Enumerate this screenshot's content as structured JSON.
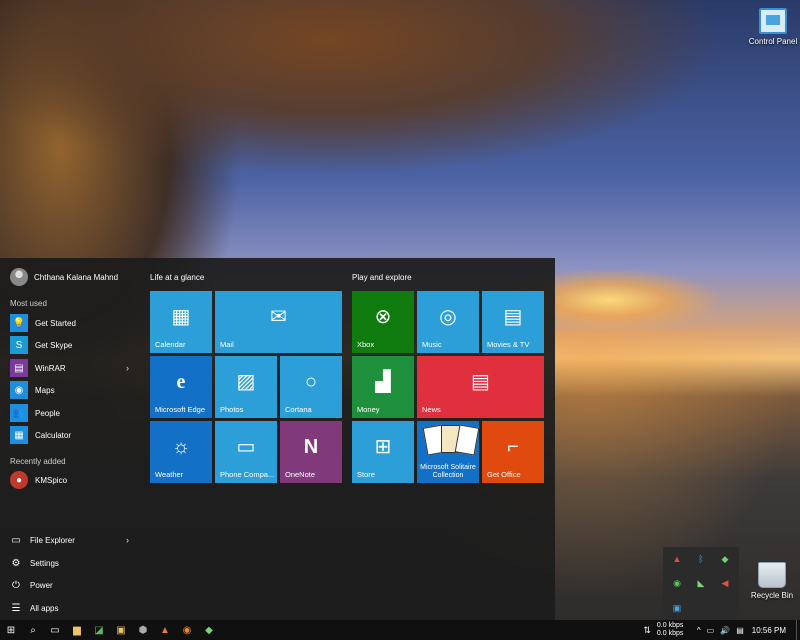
{
  "desktop": {
    "icons": [
      {
        "label": "Control Panel"
      },
      {
        "label": "Recycle Bin"
      }
    ]
  },
  "start_menu": {
    "user_name": "Chthana Kalana Mahnd",
    "most_used_header": "Most used",
    "most_used": [
      {
        "label": "Get Started",
        "color": "#1e8fdc"
      },
      {
        "label": "Get Skype",
        "color": "#1b9ad6"
      },
      {
        "label": "WinRAR",
        "color": "#7a3a9a"
      },
      {
        "label": "Maps",
        "color": "#1e8fdc"
      },
      {
        "label": "People",
        "color": "#1e8fdc"
      },
      {
        "label": "Calculator",
        "color": "#1e8fdc"
      }
    ],
    "recently_added_header": "Recently added",
    "recently_added": [
      {
        "label": "KMSpico",
        "color": "#c0392b"
      }
    ],
    "bottom": {
      "file_explorer": "File Explorer",
      "settings": "Settings",
      "power": "Power",
      "all_apps": "All apps"
    },
    "groups": {
      "life": "Life at a glance",
      "play": "Play and explore"
    },
    "tiles": {
      "calendar": "Calendar",
      "mail": "Mail",
      "edge": "Microsoft Edge",
      "photos": "Photos",
      "cortana": "Cortana",
      "weather": "Weather",
      "phone": "Phone Compa...",
      "onenote": "OneNote",
      "xbox": "Xbox",
      "music": "Music",
      "movies": "Movies & TV",
      "money": "Money",
      "news": "News",
      "store": "Store",
      "solitaire": "Microsoft Solitaire Collection",
      "office": "Get Office"
    },
    "tile_colors": {
      "blue": "#2d9fd8",
      "dark_blue": "#1270c6",
      "green": "#107c10",
      "money_green": "#1e8f3a",
      "red": "#e0303e",
      "purple": "#80397b",
      "orange": "#e04a0f",
      "teal": "#1fa0dc"
    }
  },
  "taskbar": {
    "network_up": "0.0 kbps",
    "network_down": "0.0 kbps",
    "time": "10:56 PM"
  }
}
